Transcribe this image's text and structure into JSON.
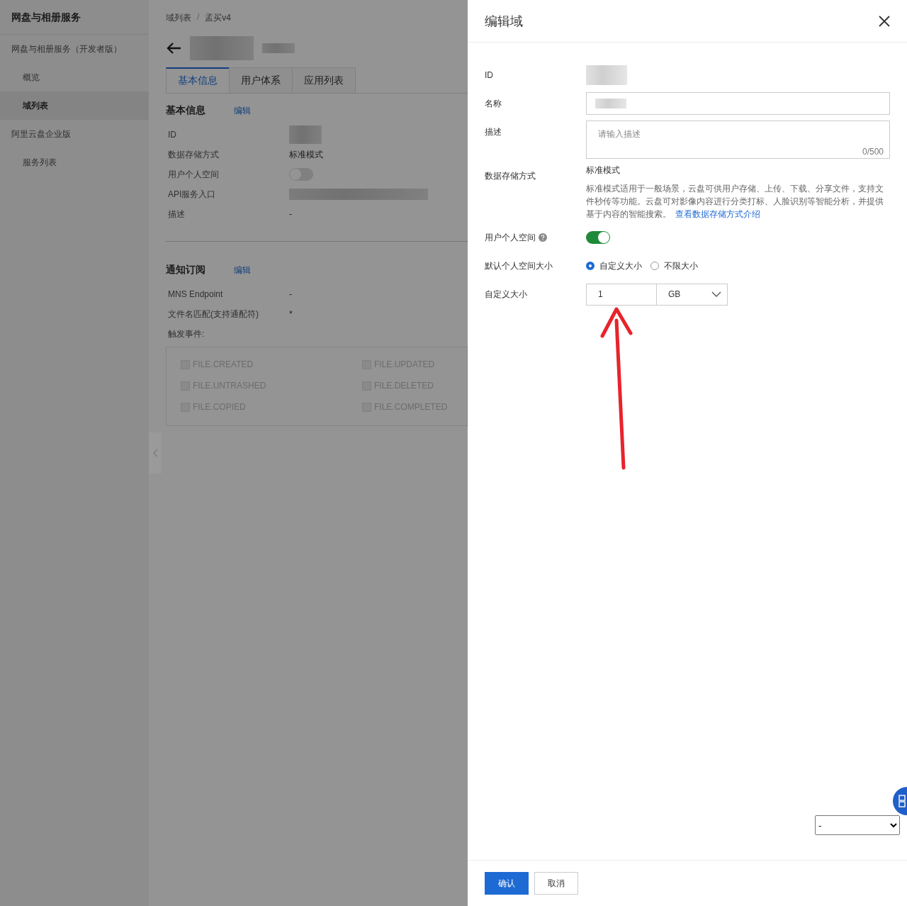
{
  "sidebar": {
    "title": "网盘与相册服务",
    "items": [
      {
        "label": "网盘与相册服务（开发者版）",
        "kind": "group",
        "selected": false
      },
      {
        "label": "概览",
        "kind": "item",
        "selected": false
      },
      {
        "label": "域列表",
        "kind": "item",
        "selected": true
      },
      {
        "label": "阿里云盘企业版",
        "kind": "group",
        "selected": false
      },
      {
        "label": "服务列表",
        "kind": "item",
        "selected": false
      }
    ]
  },
  "breadcrumb": {
    "separator": "/",
    "items": [
      "域列表",
      "孟买v4"
    ]
  },
  "tabs": [
    {
      "label": "基本信息",
      "selected": true
    },
    {
      "label": "用户体系",
      "selected": false
    },
    {
      "label": "应用列表",
      "selected": false
    }
  ],
  "basic_info": {
    "title": "基本信息",
    "edit_link": "编辑",
    "fields": [
      {
        "label": "ID",
        "kind": "redacted"
      },
      {
        "label": "数据存储方式",
        "kind": "text",
        "value": "标准模式"
      },
      {
        "label": "用户个人空间",
        "kind": "switch",
        "on": false
      },
      {
        "label": "API服务入口",
        "kind": "redacted"
      },
      {
        "label": "描述",
        "kind": "text",
        "value": "-"
      }
    ]
  },
  "notification": {
    "title": "通知订阅",
    "edit_link": "编辑",
    "fields": [
      {
        "label": "MNS Endpoint",
        "value": "-"
      },
      {
        "label": "文件名匹配(支持通配符)",
        "value": "*"
      }
    ],
    "events_label": "触发事件:",
    "events": [
      {
        "label": "FILE.CREATED",
        "checked": false,
        "disabled": true
      },
      {
        "label": "FILE.UPDATED",
        "checked": false,
        "disabled": true
      },
      {
        "label": "FILE.UNTRASHED",
        "checked": false,
        "disabled": true
      },
      {
        "label": "FILE.DELETED",
        "checked": false,
        "disabled": true
      },
      {
        "label": "FILE.COPIED",
        "checked": false,
        "disabled": true
      },
      {
        "label": "FILE.COMPLETED",
        "checked": false,
        "disabled": true
      }
    ]
  },
  "drawer": {
    "title": "编辑域",
    "fields": [
      {
        "label": "ID",
        "kind": "redacted"
      },
      {
        "label": "名称",
        "kind": "redacted-input"
      },
      {
        "label": "描述",
        "kind": "textarea",
        "placeholder": "请输入描述",
        "counter": "0/500"
      },
      {
        "label": "数据存储方式",
        "kind": "storage",
        "value": "标准模式",
        "description": "标准模式适用于一般场景，云盘可供用户存储、上传、下载、分享文件，支持文件秒传等功能。云盘可对影像内容进行分类打标、人脸识别等智能分析，并提供基于内容的智能搜索。",
        "link": "查看数据存储方式介绍"
      },
      {
        "label": "用户个人空间",
        "kind": "switch",
        "help": true,
        "on": true
      },
      {
        "label": "默认个人空间大小",
        "kind": "radio",
        "options": [
          {
            "label": "自定义大小",
            "selected": true
          },
          {
            "label": "不限大小",
            "selected": false
          }
        ]
      },
      {
        "label": "自定义大小",
        "kind": "size",
        "value": "1",
        "unit": "GB"
      }
    ],
    "buttons": [
      {
        "label": "确认",
        "kind": "primary"
      },
      {
        "label": "取消",
        "kind": "default"
      }
    ]
  },
  "page_select": {
    "value": "-"
  }
}
